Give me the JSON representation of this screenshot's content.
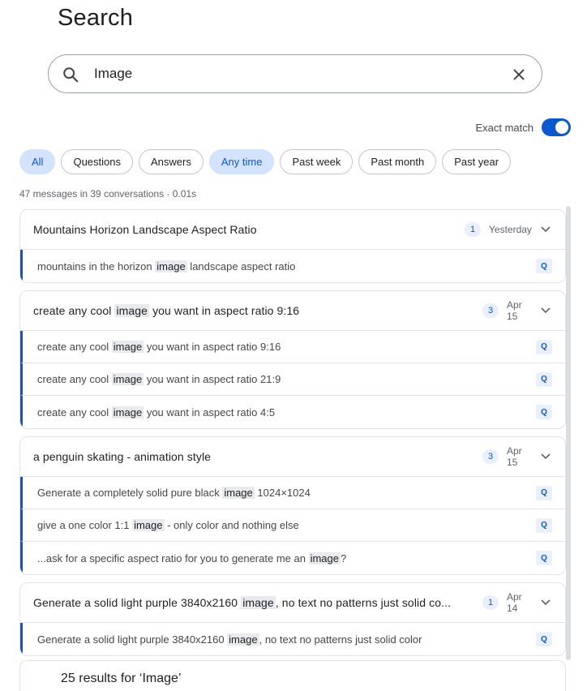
{
  "page": {
    "title": "Search"
  },
  "search": {
    "value": "Image",
    "placeholder": ""
  },
  "exact_match": {
    "label": "Exact match",
    "enabled": true
  },
  "filters": {
    "all": "All",
    "questions": "Questions",
    "answers": "Answers",
    "any_time": "Any time",
    "past_week": "Past week",
    "past_month": "Past month",
    "past_year": "Past year"
  },
  "stats": "47 messages in 39 conversations · 0.01s",
  "conversations": [
    {
      "title_parts": [
        "Mountains Horizon Landscape Aspect Ratio"
      ],
      "count": "1",
      "date": "Yesterday",
      "messages": [
        {
          "parts": [
            "mountains in the horizon ",
            "image",
            " landscape aspect ratio"
          ],
          "badge": "Q"
        }
      ]
    },
    {
      "title_parts": [
        "create any cool ",
        "image",
        " you want in aspect ratio 9:16"
      ],
      "count": "3",
      "date": "Apr 15",
      "messages": [
        {
          "parts": [
            "create any cool ",
            "image",
            " you want in aspect ratio 9:16"
          ],
          "badge": "Q"
        },
        {
          "parts": [
            "create any cool ",
            "image",
            " you want in aspect ratio 21:9"
          ],
          "badge": "Q"
        },
        {
          "parts": [
            "create any cool ",
            "image",
            " you want in aspect ratio 4:5"
          ],
          "badge": "Q"
        }
      ]
    },
    {
      "title_parts": [
        "a penguin skating - animation style"
      ],
      "count": "3",
      "date": "Apr 15",
      "messages": [
        {
          "parts": [
            "Generate a completely solid pure black ",
            "image",
            " 1024×1024"
          ],
          "badge": "Q"
        },
        {
          "parts": [
            "give a one color 1:1 ",
            "image",
            " - only color and nothing else"
          ],
          "badge": "Q"
        },
        {
          "parts": [
            "...ask for a specific aspect ratio for you to generate me an ",
            "image",
            "?"
          ],
          "badge": "Q"
        }
      ]
    },
    {
      "title_parts": [
        "Generate a solid light purple 3840x2160 ",
        "image",
        ", no text no patterns just solid co..."
      ],
      "count": "1",
      "date": "Apr 14",
      "messages": [
        {
          "parts": [
            "Generate a solid light purple 3840x2160 ",
            "image",
            ", no text no patterns just solid color"
          ],
          "badge": "Q"
        }
      ]
    }
  ],
  "footer": "25 results for ‘Image’",
  "colors": {
    "accent": "#0b57d0",
    "chip_selected_bg": "#d3e3fd",
    "highlight_bg": "#e8eaed"
  }
}
